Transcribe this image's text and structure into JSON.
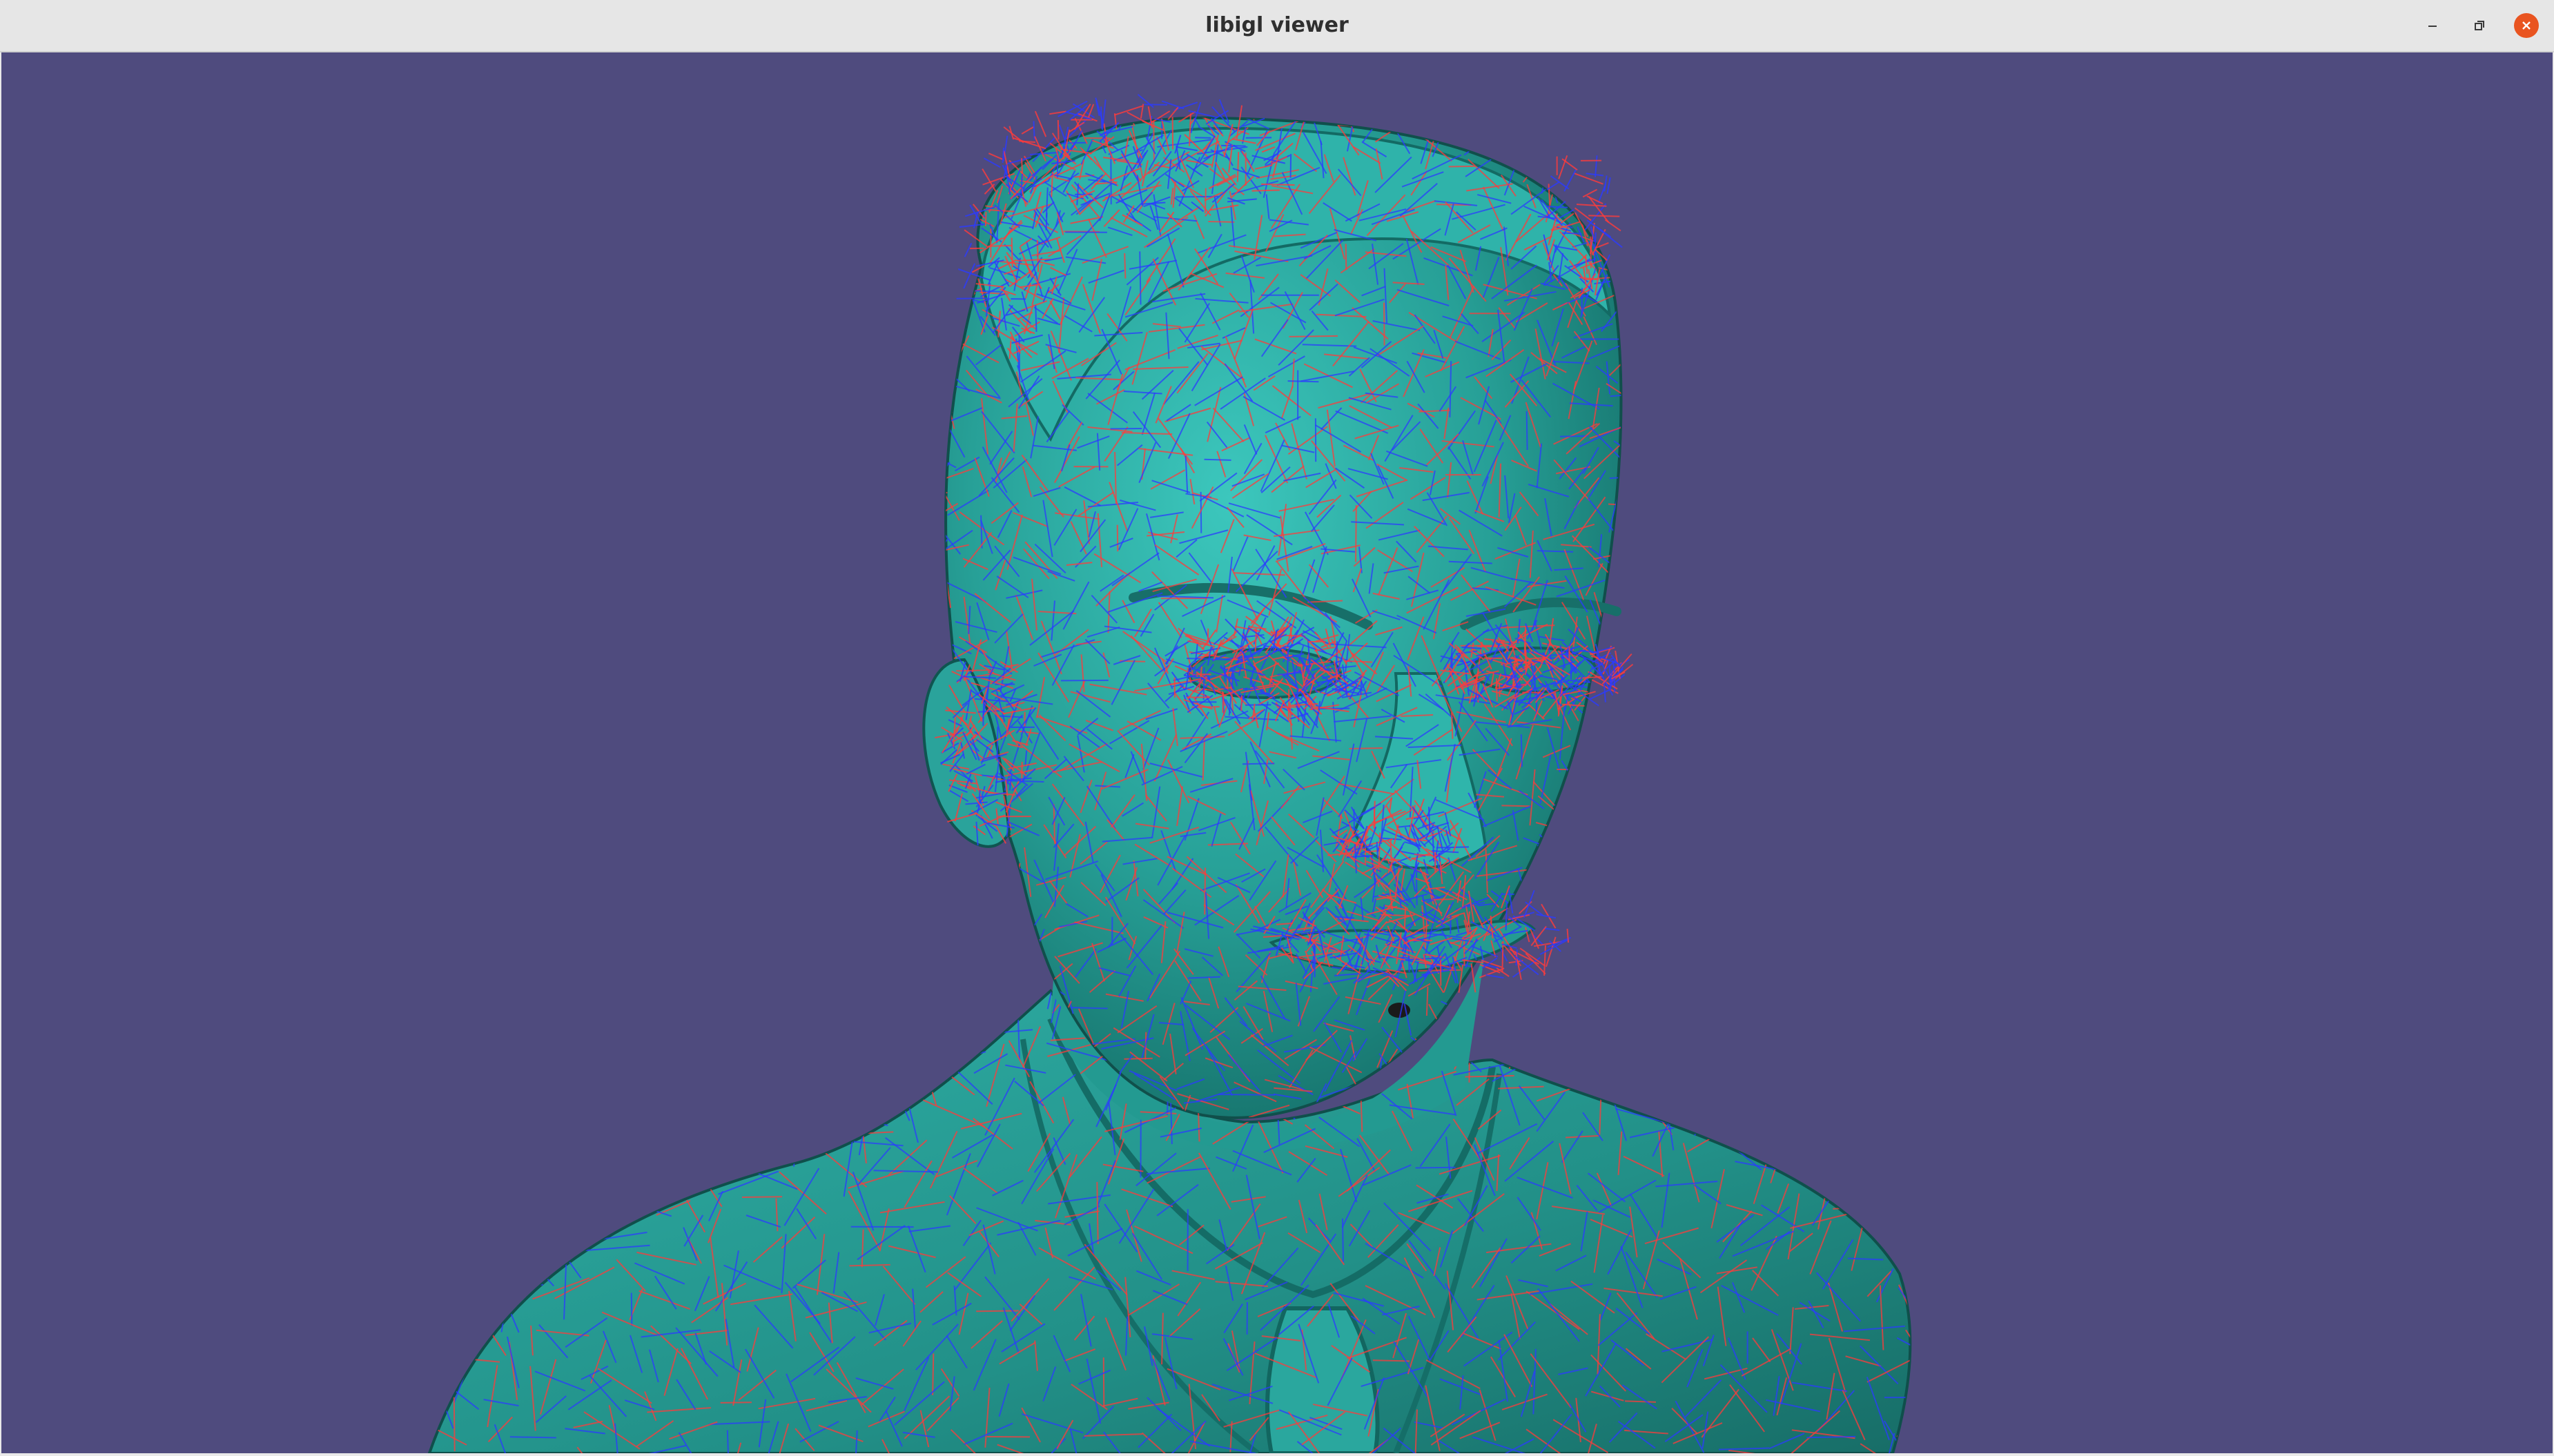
{
  "window": {
    "title": "libigl viewer",
    "controls": [
      "minimize-icon",
      "restore-icon",
      "close-icon"
    ]
  },
  "viewport": {
    "background_color": "#4f4b7e",
    "mesh_color": "#2aa39b",
    "direction_field_colors": [
      "#ff3b3b",
      "#2b3bff"
    ]
  }
}
